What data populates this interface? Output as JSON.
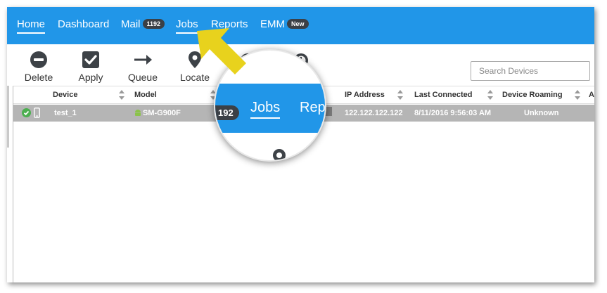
{
  "nav": {
    "items": [
      {
        "label": "Home"
      },
      {
        "label": "Dashboard"
      },
      {
        "label": "Mail",
        "badge": "1192"
      },
      {
        "label": "Jobs"
      },
      {
        "label": "Reports"
      },
      {
        "label": "EMM",
        "badge": "New"
      }
    ],
    "active": "Home"
  },
  "toolbar": {
    "delete_label": "Delete",
    "apply_label": "Apply",
    "queue_label": "Queue",
    "locate_label": "Locate"
  },
  "search": {
    "placeholder": "Search Devices"
  },
  "table": {
    "columns": [
      "Device",
      "Model",
      "IP Address",
      "Last Connected",
      "Device Roaming",
      "A"
    ],
    "rows": [
      {
        "device": "test_1",
        "model": "SM-G900F",
        "ip": "122.122.122.122",
        "last_connected": "8/11/2016 9:56:03 AM",
        "roaming": "Unknown"
      }
    ]
  },
  "magnifier": {
    "badge_fragment": "192",
    "jobs_label": "Jobs",
    "reports_fragment": "Rep"
  },
  "colors": {
    "navbar": "#2196e8",
    "badge": "#3b4046",
    "row_selected": "#b5b5b5",
    "status_ok": "#4caf50",
    "android": "#8bc34a",
    "arrow": "#e8d21d"
  }
}
